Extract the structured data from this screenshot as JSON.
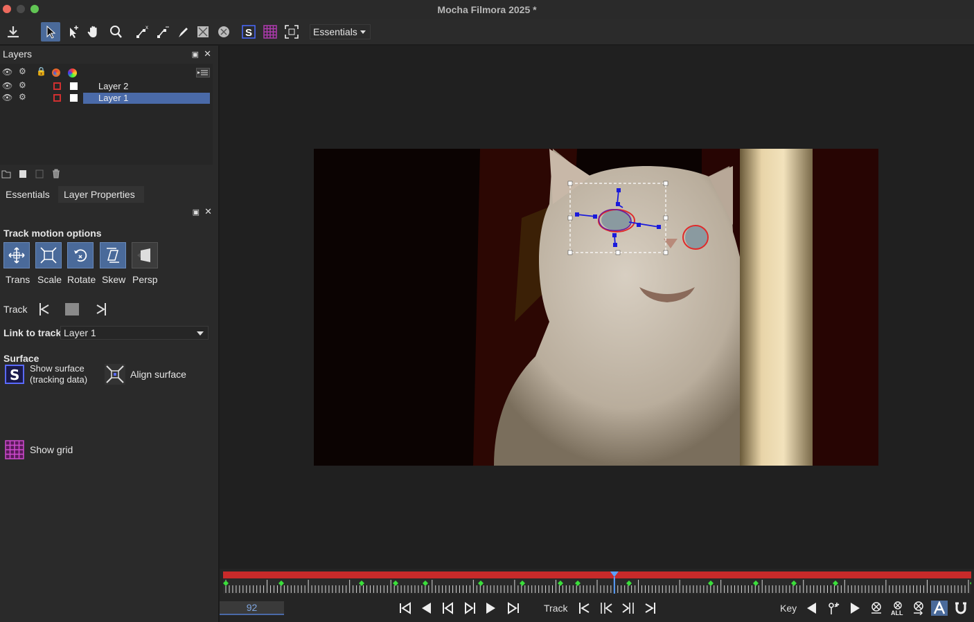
{
  "window": {
    "title": "Mocha Filmora 2025 *"
  },
  "toolbar": {
    "workspace": "Essentials"
  },
  "layers_panel": {
    "title": "Layers",
    "layers": [
      {
        "name": "Layer 2",
        "selected": false
      },
      {
        "name": "Layer 1",
        "selected": true
      }
    ]
  },
  "tabs": [
    {
      "label": "Essentials",
      "active": false
    },
    {
      "label": "Layer Properties",
      "active": true
    }
  ],
  "properties": {
    "track_motion_title": "Track motion options",
    "motion_options": [
      {
        "label": "Trans",
        "on": true
      },
      {
        "label": "Scale",
        "on": true
      },
      {
        "label": "Rotate",
        "on": true
      },
      {
        "label": "Skew",
        "on": true
      },
      {
        "label": "Persp",
        "on": false
      }
    ],
    "track_label": "Track",
    "link_to_track_label": "Link to track",
    "link_to_track_value": "Layer 1",
    "surface_title": "Surface",
    "show_surface_line1": "Show surface",
    "show_surface_line2": "(tracking data)",
    "align_surface": "Align surface",
    "show_grid": "Show grid"
  },
  "timeline": {
    "current_frame": "92",
    "playhead_fraction": 0.523
  },
  "bottom_bar": {
    "track_label": "Track",
    "key_label": "Key",
    "all_label": "ALL"
  },
  "colors": {
    "accent": "#4a6a9a",
    "timeline_red": "#c82a2a",
    "selection": "#4a6aa8",
    "keyframe_green": "#3adf3a",
    "spline_blue": "#1a1adc",
    "spline_red": "#e02a2a"
  }
}
